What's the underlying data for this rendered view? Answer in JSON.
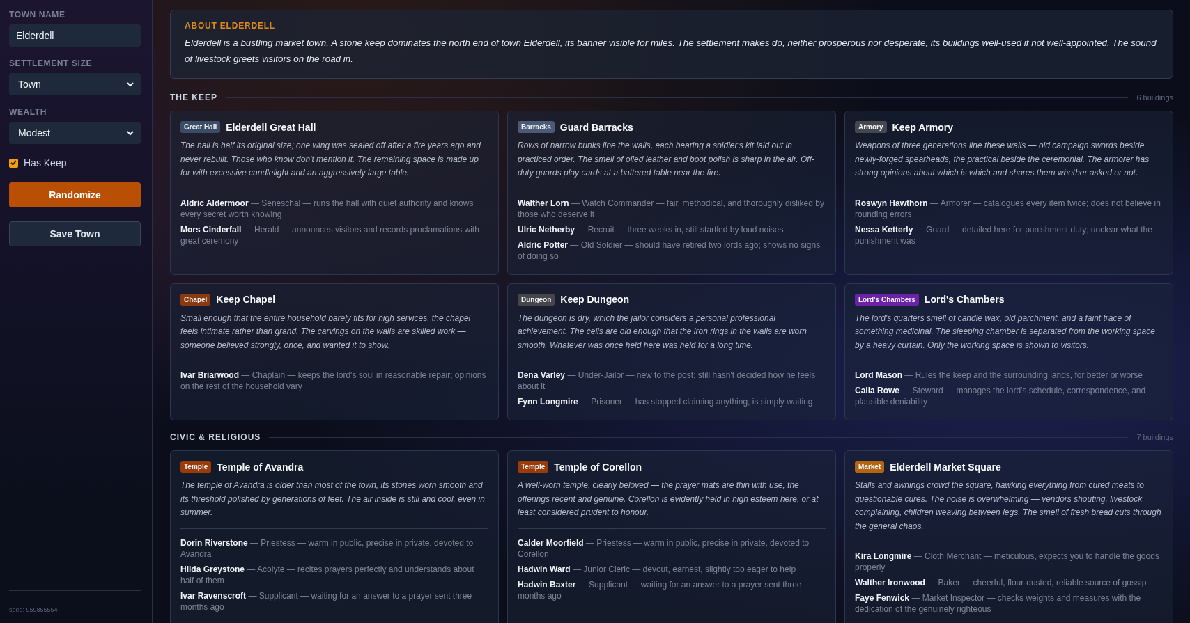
{
  "sidebar": {
    "fields": [
      {
        "label": "TOWN NAME",
        "kind": "text",
        "value": "Elderdell"
      },
      {
        "label": "SETTLEMENT SIZE",
        "kind": "select",
        "value": "Town"
      },
      {
        "label": "WEALTH",
        "kind": "select",
        "value": "Modest"
      }
    ],
    "has_keep": {
      "label": "Has Keep",
      "checked": true
    },
    "buttons": [
      {
        "label": "Randomize",
        "kind": "primary"
      },
      {
        "label": "Save Town",
        "kind": "secondary"
      }
    ],
    "seed": "seed: 959855554"
  },
  "about": {
    "title": "ABOUT ELDERDELL",
    "text": "Elderdell is a bustling market town. A stone keep dominates the north end of town Elderdell, its banner visible for miles. The settlement makes do, neither prosperous nor desperate, its buildings well-used if not well-appointed. The sound of livestock greets visitors on the road in."
  },
  "sections": [
    {
      "title": "THE KEEP",
      "count": "6 buildings",
      "buildings": [
        {
          "type": "Great Hall",
          "color": "#3b4d66",
          "name": "Elderdell Great Hall",
          "description": "The hall is half its original size; one wing was sealed off after a fire years ago and never rebuilt. Those who know don't mention it. The remaining space is made up for with excessive candlelight and an aggressively large table.",
          "people": [
            "**Aldric Aldermoor** — Seneschal — runs the hall with quiet authority and knows every secret worth knowing",
            "**Mors Cinderfall** — Herald — announces visitors and records proclamations with great ceremony"
          ]
        },
        {
          "type": "Barracks",
          "color": "#4a5a78",
          "name": "Guard Barracks",
          "description": "Rows of narrow bunks line the walls, each bearing a soldier's kit laid out in practiced order. The smell of oiled leather and boot polish is sharp in the air. Off-duty guards play cards at a battered table near the fire.",
          "people": [
            "**Walther Lorn** — Watch Commander — fair, methodical, and thoroughly disliked by those who deserve it",
            "**Ulric Netherby** — Recruit — three weeks in, still startled by loud noises",
            "**Aldric Potter** — Old Soldier — should have retired two lords ago; shows no signs of doing so"
          ]
        },
        {
          "type": "Armory",
          "color": "#45474e",
          "name": "Keep Armory",
          "description": "Weapons of three generations line these walls — old campaign swords beside newly-forged spearheads, the practical beside the ceremonial. The armorer has strong opinions about which is which and shares them whether asked or not.",
          "people": [
            "**Roswyn Hawthorn** — Armorer — catalogues every item twice; does not believe in rounding errors",
            "**Nessa Ketterly** — Guard — detailed here for punishment duty; unclear what the punishment was"
          ]
        },
        {
          "type": "Chapel",
          "color": "#8a3a0e",
          "name": "Keep Chapel",
          "description": "Small enough that the entire household barely fits for high services, the chapel feels intimate rather than grand. The carvings on the walls are skilled work — someone believed strongly, once, and wanted it to show.",
          "people": [
            "**Ivar Briarwood** — Chaplain — keeps the lord's soul in reasonable repair; opinions on the rest of the household vary"
          ]
        },
        {
          "type": "Dungeon",
          "color": "#46464a",
          "name": "Keep Dungeon",
          "description": "The dungeon is dry, which the jailor considers a personal professional achievement. The cells are old enough that the iron rings in the walls are worn smooth. Whatever was once held here was held for a long time.",
          "people": [
            "**Dena Varley** — Under-Jailor — new to the post; still hasn't decided how he feels about it",
            "**Fynn Longmire** — Prisoner — has stopped claiming anything; is simply waiting"
          ]
        },
        {
          "type": "Lord's Chambers",
          "color": "#6b21a8",
          "name": "Lord's Chambers",
          "description": "The lord's quarters smell of candle wax, old parchment, and a faint trace of something medicinal. The sleeping chamber is separated from the working space by a heavy curtain. Only the working space is shown to visitors.",
          "people": [
            "**Lord Mason** — Rules the keep and the surrounding lands, for better or worse",
            "**Calla Rowe** — Steward — manages the lord's schedule, correspondence, and plausible deniability"
          ]
        }
      ]
    },
    {
      "title": "CIVIC & RELIGIOUS",
      "count": "7 buildings",
      "buildings": [
        {
          "type": "Temple",
          "color": "#9a3b0a",
          "name": "Temple of Avandra",
          "description": "The temple of Avandra is older than most of the town, its stones worn smooth and its threshold polished by generations of feet. The air inside is still and cool, even in summer.",
          "people": [
            "**Dorin Riverstone** — Priestess — warm in public, precise in private, devoted to Avandra",
            "**Hilda Greystone** — Acolyte — recites prayers perfectly and understands about half of them",
            "**Ivar Ravenscroft** — Supplicant — waiting for an answer to a prayer sent three months ago"
          ]
        },
        {
          "type": "Temple",
          "color": "#9a3b0a",
          "name": "Temple of Corellon",
          "description": "A well-worn temple, clearly beloved — the prayer mats are thin with use, the offerings recent and genuine. Corellon is evidently held in high esteem here, or at least considered prudent to honour.",
          "people": [
            "**Calder Moorfield** — Priestess — warm in public, precise in private, devoted to Corellon",
            "**Hadwin Ward** — Junior Cleric — devout, earnest, slightly too eager to help",
            "**Hadwin Baxter** — Supplicant — waiting for an answer to a prayer sent three months ago"
          ]
        },
        {
          "type": "Market",
          "color": "#b5650d",
          "name": "Elderdell Market Square",
          "description": "Stalls and awnings crowd the square, hawking everything from cured meats to questionable cures. The noise is overwhelming — vendors shouting, livestock complaining, children weaving between legs. The smell of fresh bread cuts through the general chaos.",
          "people": [
            "**Kira Longmire** — Cloth Merchant — meticulous, expects you to handle the goods properly",
            "**Walther Ironwood** — Baker — cheerful, flour-dusted, reliable source of gossip",
            "**Faye Fenwick** — Market Inspector — checks weights and measures with the dedication of the genuinely righteous"
          ]
        }
      ]
    }
  ]
}
